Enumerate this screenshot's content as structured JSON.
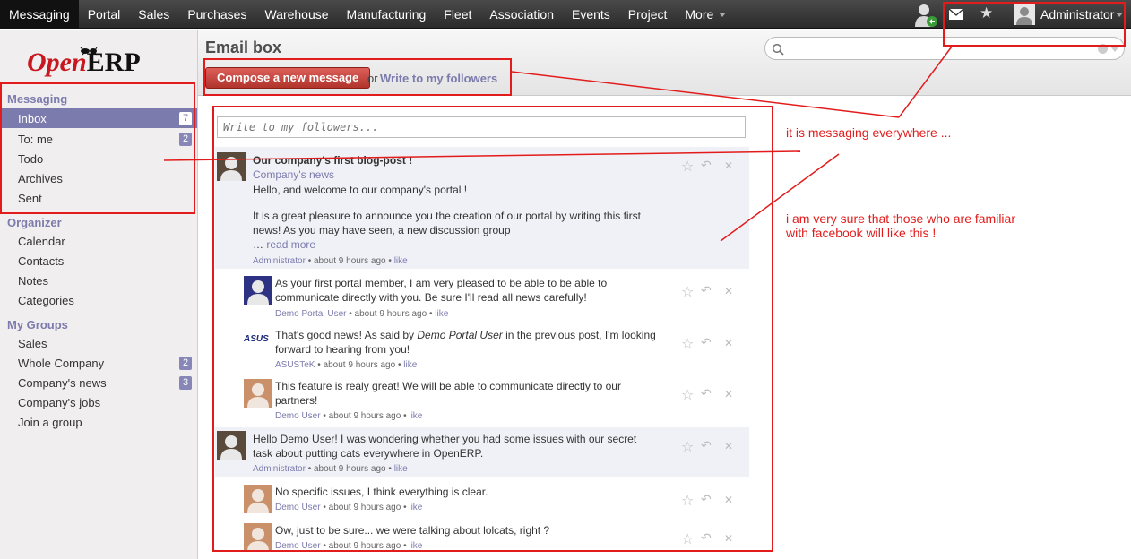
{
  "topmenu": {
    "items": [
      "Messaging",
      "Portal",
      "Sales",
      "Purchases",
      "Warehouse",
      "Manufacturing",
      "Fleet",
      "Association",
      "Events",
      "Project",
      "More"
    ],
    "user": "Administrator"
  },
  "sidebar": {
    "logo_open": "Open",
    "logo_erp": "ERP",
    "sections": {
      "messaging": {
        "title": "Messaging",
        "items": [
          {
            "label": "Inbox",
            "badge": "7"
          },
          {
            "label": "To: me",
            "badge": "2"
          },
          {
            "label": "Todo"
          },
          {
            "label": "Archives"
          },
          {
            "label": "Sent"
          }
        ]
      },
      "organizer": {
        "title": "Organizer",
        "items": [
          {
            "label": "Calendar"
          },
          {
            "label": "Contacts"
          },
          {
            "label": "Notes"
          },
          {
            "label": "Categories"
          }
        ]
      },
      "groups": {
        "title": "My Groups",
        "items": [
          {
            "label": "Sales"
          },
          {
            "label": "Whole Company",
            "badge": "2"
          },
          {
            "label": "Company's news",
            "badge": "3"
          },
          {
            "label": "Company's jobs"
          },
          {
            "label": "Join a group"
          }
        ]
      }
    }
  },
  "header": {
    "title": "Email box",
    "compose_label": "Compose a new message",
    "or_text": "or",
    "write_link": "Write to my followers",
    "search_placeholder": ""
  },
  "composer": {
    "placeholder": "Write to my followers..."
  },
  "messages": [
    {
      "title": "Our company's first blog-post !",
      "subtitle": "Company's news",
      "body1": "Hello, and welcome to our company's portal !",
      "body2": "It is a great pleasure to announce you the creation of our portal by writing this first news! As you may have seen, a new discussion group",
      "ellipsis": "… ",
      "read_more": "read more",
      "author": "Administrator",
      "time": "about 9 hours ago",
      "like": "like"
    },
    {
      "body": "As your first portal member, I am very pleased to be able to be able to communicate directly with you. Be sure I'll read all news carefully!",
      "author": "Demo Portal User",
      "time": "about 9 hours ago",
      "like": "like"
    },
    {
      "body_a": "That's good news! As said by ",
      "body_em": "Demo Portal User",
      "body_b": " in the previous post, I'm looking forward to hearing from you!",
      "author": "ASUSTeK",
      "time": "about 9 hours ago",
      "like": "like",
      "logo": "ASUS"
    },
    {
      "body": "This feature is realy great! We will be able to communicate directly to our partners!",
      "author": "Demo User",
      "time": "about 9 hours ago",
      "like": "like"
    },
    {
      "body": "Hello Demo User! I was wondering whether you had some issues with our secret task about putting cats everywhere in OpenERP.",
      "author": "Administrator",
      "time": "about 9 hours ago",
      "like": "like"
    },
    {
      "body": "No specific issues, I think everything is clear.",
      "author": "Demo User",
      "time": "about 9 hours ago",
      "like": "like"
    },
    {
      "body": "Ow, just to be sure... we were talking about lolcats, right ?",
      "author": "Demo User",
      "time": "about 9 hours ago",
      "like": "like"
    }
  ],
  "meta_sep": "•",
  "annotations": {
    "everywhere": "it is messaging everywhere ...",
    "facebook": "i am very sure that those who are familiar with facebook will like this !"
  },
  "colors": {
    "accent": "#7c7bad",
    "compose": "#c43c35",
    "annotation": "#e21c1c"
  }
}
